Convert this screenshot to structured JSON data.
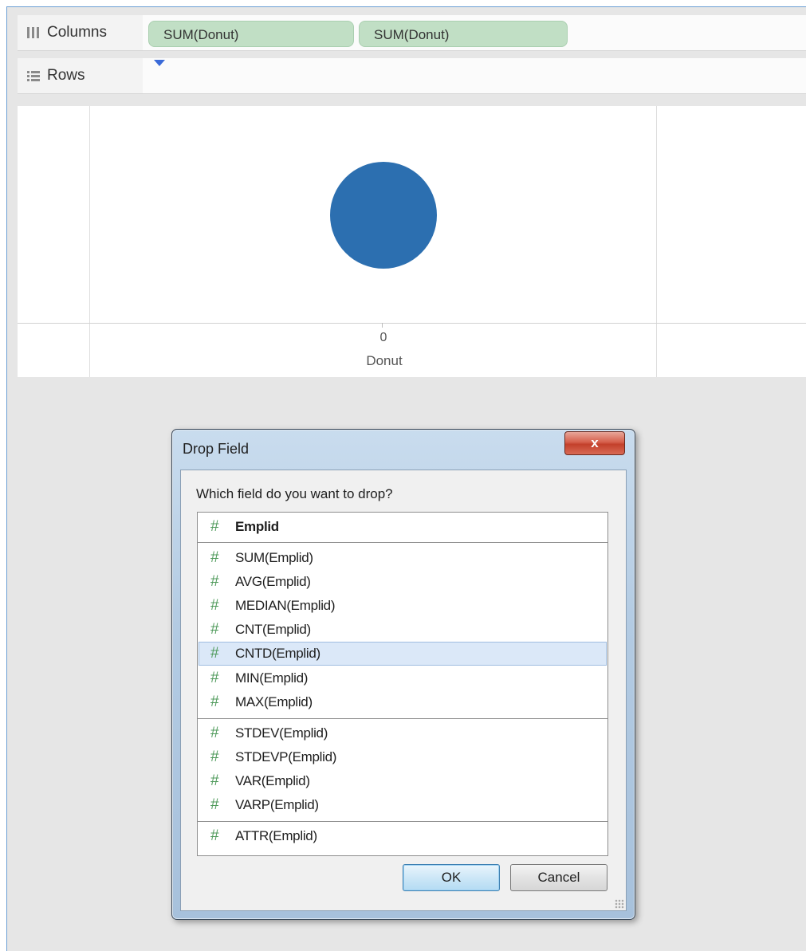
{
  "shelves": {
    "columns_label": "Columns",
    "rows_label": "Rows",
    "column_pills": [
      "SUM(Donut)",
      "SUM(Donut)"
    ]
  },
  "view": {
    "axis_tick": "0",
    "axis_title": "Donut",
    "mark_color": "#2c6fb0"
  },
  "dialog": {
    "title": "Drop Field",
    "close_label": "x",
    "prompt": "Which field do you want to drop?",
    "fields": [
      {
        "label": "Emplid",
        "bold": true
      },
      {
        "label": "SUM(Emplid)"
      },
      {
        "label": "AVG(Emplid)"
      },
      {
        "label": "MEDIAN(Emplid)"
      },
      {
        "label": "CNT(Emplid)"
      },
      {
        "label": "CNTD(Emplid)",
        "selected": true
      },
      {
        "label": "MIN(Emplid)"
      },
      {
        "label": "MAX(Emplid)"
      },
      {
        "label": "STDEV(Emplid)"
      },
      {
        "label": "STDEVP(Emplid)"
      },
      {
        "label": "VAR(Emplid)"
      },
      {
        "label": "VARP(Emplid)"
      },
      {
        "label": "ATTR(Emplid)"
      }
    ],
    "field_icon": "#",
    "ok_label": "OK",
    "cancel_label": "Cancel"
  }
}
